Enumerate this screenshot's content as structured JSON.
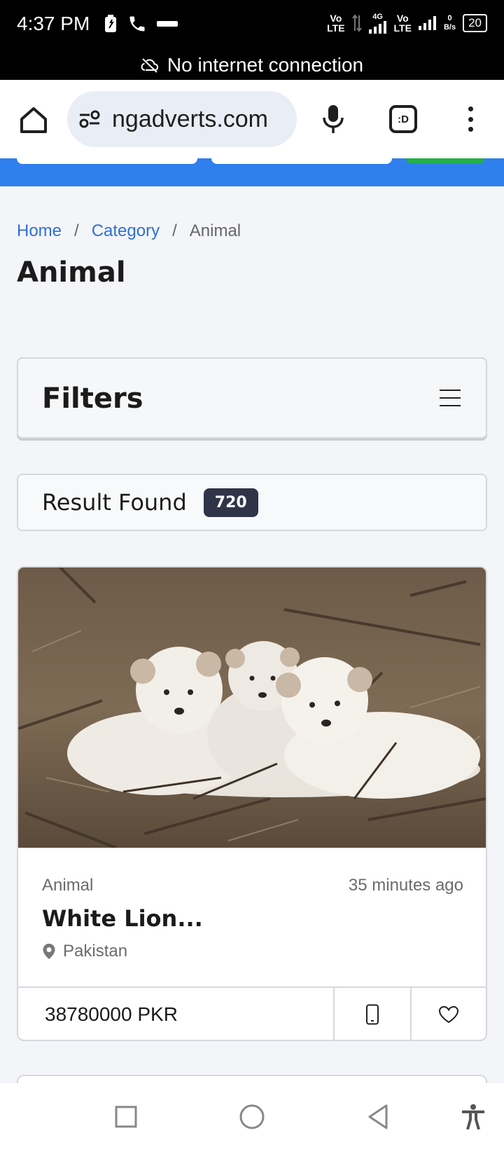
{
  "status_bar": {
    "time": "4:37 PM",
    "net1_top": "Vo",
    "net1_bottom": "LTE",
    "net2": "4G",
    "net3_top": "Vo",
    "net3_bottom": "LTE",
    "speed_top": "0",
    "speed_bottom": "B/s",
    "battery": "20"
  },
  "offline_banner": {
    "text": "No internet connection",
    "icon": "cloud-off-icon"
  },
  "browser": {
    "url": "ngadverts.com",
    "tabs_label": ":D",
    "icons": [
      "home-icon",
      "site-settings-icon",
      "mic-icon",
      "tabs-icon",
      "more-vert-icon"
    ]
  },
  "breadcrumb": {
    "home": "Home",
    "sep1": "/",
    "category": "Category",
    "sep2": "/",
    "current": "Animal"
  },
  "page_title": "Animal",
  "filters": {
    "title": "Filters",
    "icon": "hamburger-icon"
  },
  "results": {
    "label": "Result Found",
    "count": "720"
  },
  "listing": {
    "category": "Animal",
    "posted": "35 minutes ago",
    "title": "White Lion...",
    "location": "Pakistan",
    "price": "38780000 PKR",
    "image_subject": "three white lion cubs lying on dry ground",
    "icons": [
      "location-pin-icon",
      "phone-icon",
      "heart-icon"
    ]
  },
  "nav_bar": {
    "icons": [
      "recents-square-icon",
      "home-circle-icon",
      "back-triangle-icon",
      "accessibility-icon"
    ]
  },
  "colors": {
    "accent": "#2f7fef",
    "badge": "#303449",
    "link": "#2f6fd6"
  }
}
